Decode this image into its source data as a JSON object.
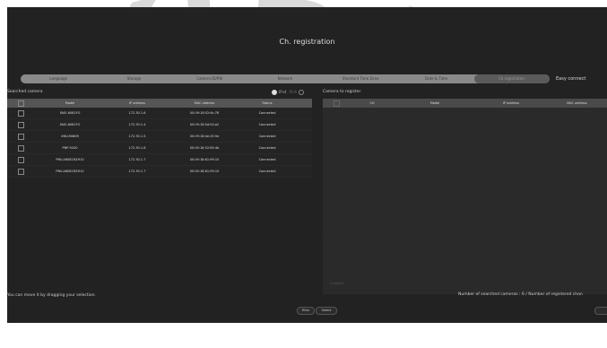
{
  "watermark": "KIBUTZ",
  "dialog": {
    "title": "Ch. registration",
    "tabs": [
      "Language",
      "Storage",
      "Camera ID/PW",
      "Network",
      "Standard Time Zone",
      "Date & Time",
      "Ch.registration"
    ],
    "active_tab": 6,
    "easy_connect": "Easy connect"
  },
  "left": {
    "label": "Searched camera",
    "ip_options": [
      "IPv4",
      "IPv6"
    ],
    "selected_ip": "IPv4",
    "columns": [
      "Model",
      "IP address",
      "MAC address",
      "Status"
    ],
    "rows": [
      {
        "model": "XNO-6081FO",
        "ip": "172.30.1.6",
        "mac": "00:09:18:52:6c:78",
        "status": "Connected"
      },
      {
        "model": "XNO-6081FO",
        "ip": "172.30.1.4",
        "mac": "00:09:18:5d:54:a2",
        "status": "Connected"
      },
      {
        "model": "XNV-8080R",
        "ip": "172.30.1.5",
        "mac": "00:09:18:4e:25:5e",
        "status": "Connected"
      },
      {
        "model": "PNP-9200",
        "ip": "172.30.1.8",
        "mac": "00:09:18:52:65:4b",
        "status": "Connected"
      },
      {
        "model": "PNV-A6081RZH10",
        "ip": "172.30.1.7",
        "mac": "00:09:18:61:99:10",
        "status": "Connected"
      },
      {
        "model": "PNV-A6081RZH10",
        "ip": "172.30.1.7",
        "mac": "00:09:18:61:99:10",
        "status": "Connected"
      }
    ],
    "hint": "You can move it by dragging your selection.",
    "buttons": [
      "Filter",
      "Select"
    ]
  },
  "right": {
    "label": "Camera to register",
    "columns": [
      "CH",
      "Model",
      "IP address",
      "MAC address"
    ],
    "dim_label": "Unregistr",
    "count_text": "Number of searched cameras : 6 / Number of registered chan"
  }
}
